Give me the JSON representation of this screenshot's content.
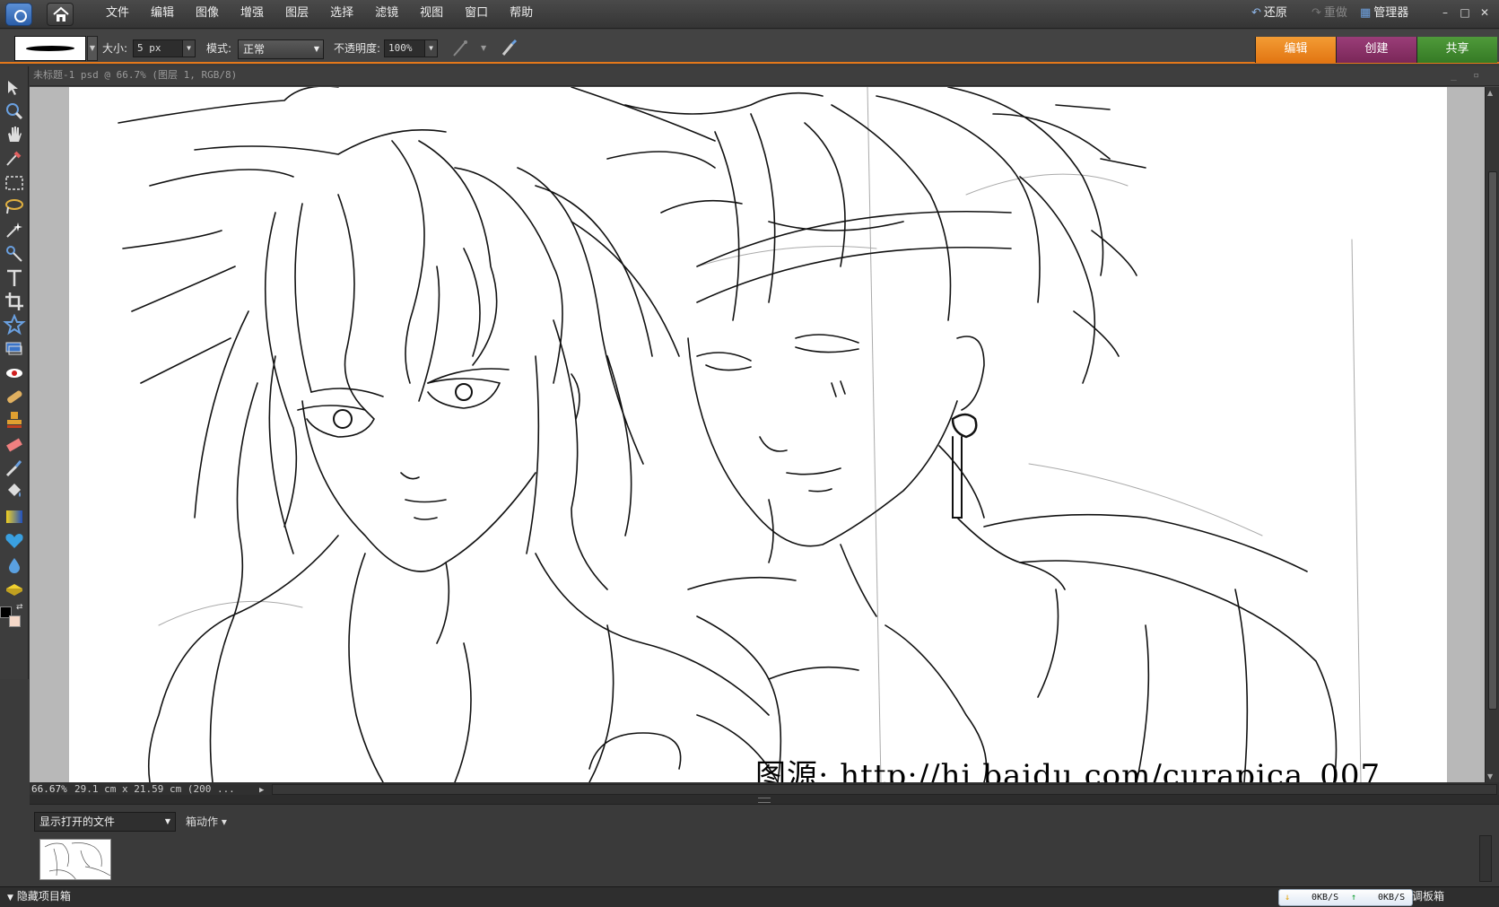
{
  "menubar": {
    "items": [
      "文件",
      "编辑",
      "图像",
      "增强",
      "图层",
      "选择",
      "滤镜",
      "视图",
      "窗口",
      "帮助"
    ],
    "undo_label": "还原",
    "redo_label": "重做",
    "manager_label": "管理器",
    "window_controls": [
      "–",
      "□",
      "✕"
    ]
  },
  "options": {
    "size_label": "大小:",
    "size_value": "5 px",
    "mode_label": "模式:",
    "mode_value": "正常",
    "opacity_label": "不透明度:",
    "opacity_value": "100%"
  },
  "mode_tabs": [
    "编辑",
    "创建",
    "共享"
  ],
  "document": {
    "title": "未标题-1 psd @ 66.7% (图层 1, RGB/8)",
    "watermark": "图源: http://hi.baidu.com/curapica_007",
    "zoom": "66.67%",
    "dimensions": "29.1 cm x 21.59 cm (200 ..."
  },
  "project_bin": {
    "dropdown_value": "显示打开的文件",
    "actions_label": "箱动作"
  },
  "bottom": {
    "hide_bin_label": "隐藏项目箱",
    "download_speed": "0KB/S",
    "upload_speed": "0KB/S",
    "panel_bin_label": "调板箱"
  },
  "colors": {
    "accent_edit": "#e27512",
    "accent_create": "#7a2758",
    "accent_share": "#357a25"
  }
}
